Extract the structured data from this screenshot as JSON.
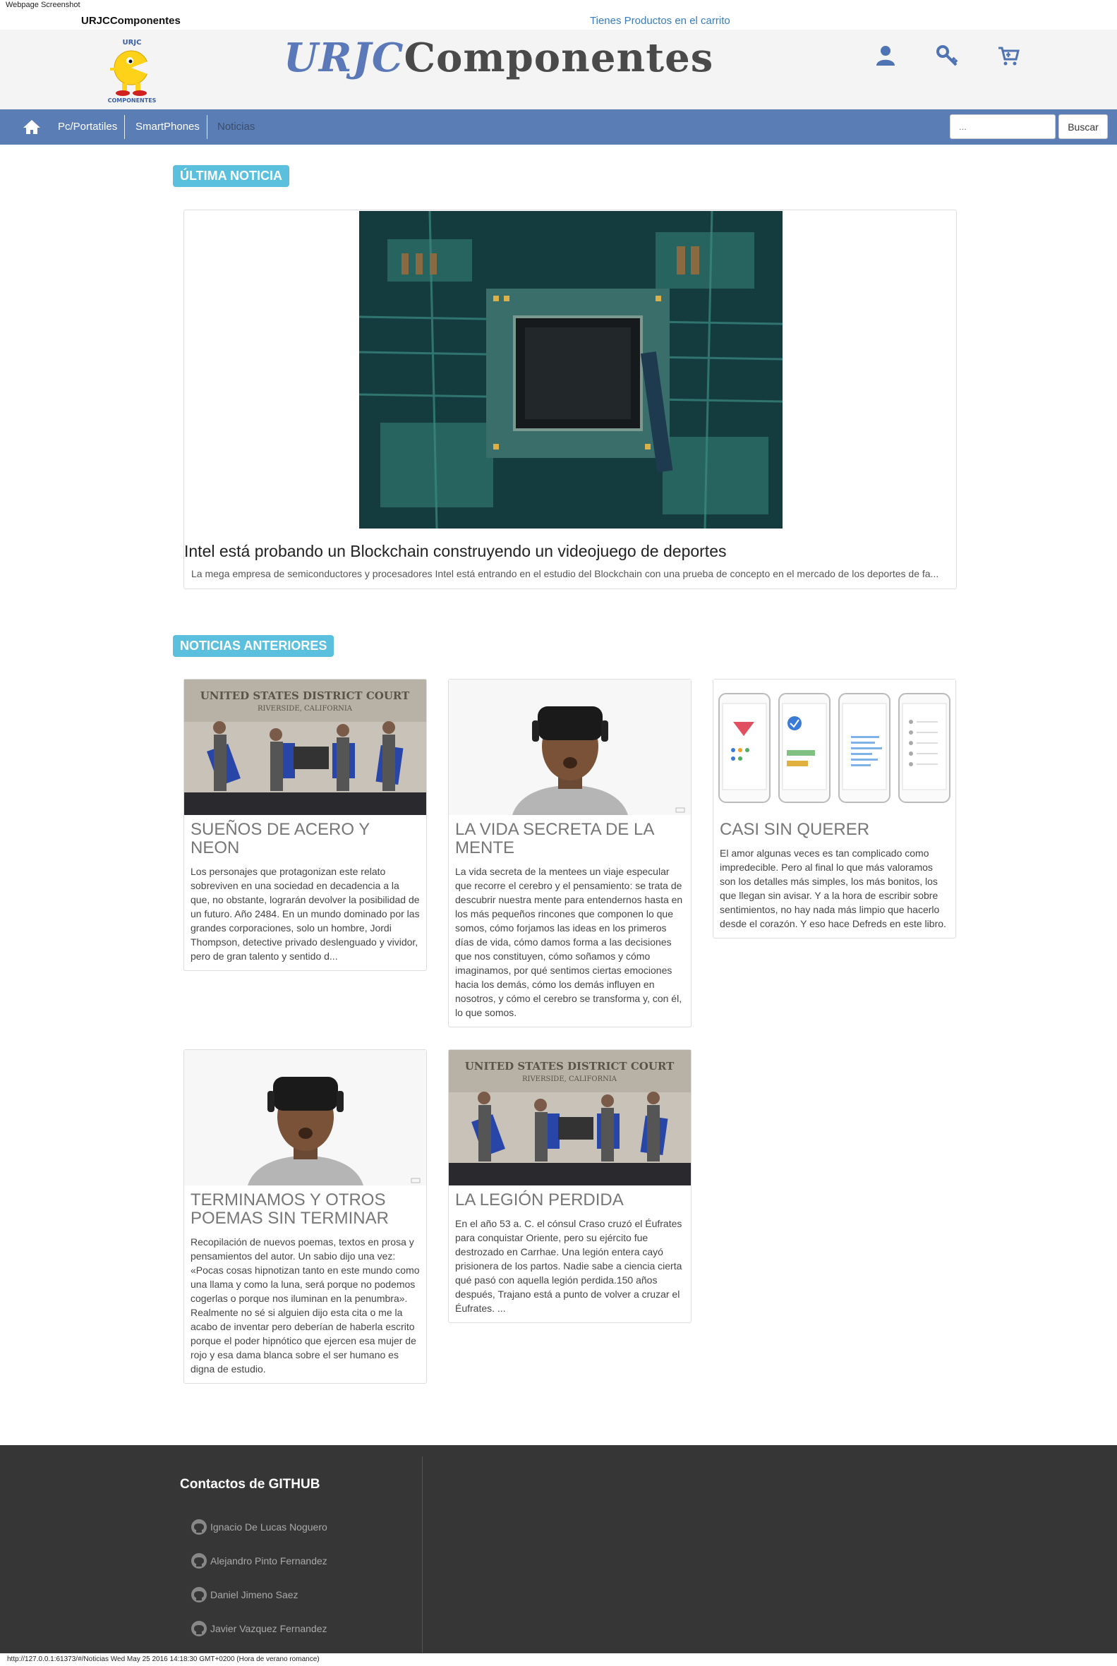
{
  "screenshot_caption": "Webpage Screenshot",
  "top": {
    "brand": "URJCComponentes",
    "cart_message": "Tienes Productos en el carrito"
  },
  "header": {
    "title_part1": "URJC",
    "title_part2": "Componentes",
    "logo_text_top": "URJC",
    "logo_text_bottom": "COMPONENTES",
    "icons": [
      "user-icon",
      "key-icon",
      "cart-icon"
    ]
  },
  "nav": {
    "items": [
      "Pc/Portatiles",
      "SmartPhones",
      "Noticias"
    ],
    "search_placeholder": "...",
    "search_button": "Buscar"
  },
  "latest": {
    "label": "ÚLTIMA NOTICIA",
    "title": "Intel está probando un Blockchain construyendo un videojuego de deportes",
    "desc": "La mega empresa de semiconductores y procesadores Intel está entrando en el estudio del Blockchain con una prueba de concepto en el mercado de los deportes de fa..."
  },
  "previous": {
    "label": "NOTICIAS ANTERIORES",
    "cards": [
      {
        "title": "SUEÑOS DE ACERO Y NEON",
        "desc": "Los personajes que protagonizan este relato sobreviven en una sociedad en decadencia a la que, no obstante, lograrán devolver la posibilidad de un futuro. Año 2484. En un mundo dominado por las grandes corporaciones, solo un hombre, Jordi Thompson, detective privado deslenguado y vividor, pero de gran talento y sentido d...",
        "image_sign": "UNITED STATES DISTRICT COURT",
        "image_sub": "RIVERSIDE, CALIFORNIA"
      },
      {
        "title": "LA VIDA SECRETA DE LA MENTE",
        "desc": "La vida secreta de la mentees un viaje especular que recorre el cerebro y el pensamiento: se trata de descubrir nuestra mente para entendernos hasta en los más pequeños rincones que componen lo que somos, cómo forjamos las ideas en los primeros días de vida, cómo damos forma a las decisiones que nos constituyen, cómo soñamos y cómo imaginamos, por qué sentimos ciertas emociones hacia los demás, cómo los demás influyen en nosotros, y cómo el cerebro se transforma y, con él, lo que somos."
      },
      {
        "title": "CASI SIN QUERER",
        "desc": "El amor algunas veces es tan complicado como impredecible. Pero al final lo que más valoramos son los detalles más simples, los más bonitos, los que llegan sin avisar. Y a la hora de escribir sobre sentimientos, no hay nada más limpio que hacerlo desde el corazón. Y eso hace Defreds en este libro."
      },
      {
        "title": "TERMINAMOS Y OTROS POEMAS SIN TERMINAR",
        "desc": "Recopilación de nuevos poemas, textos en prosa y pensamientos del autor. Un sabio dijo una vez: «Pocas cosas hipnotizan tanto en este mundo como una llama y como la luna, será porque no podemos cogerlas o porque nos iluminan en la penumbra». Realmente no sé si alguien dijo esta cita o me la acabo de inventar pero deberían de haberla escrito porque el poder hipnótico que ejercen esa mujer de rojo y esa dama blanca sobre el ser humano es digna de estudio."
      },
      {
        "title": "LA LEGIÓN PERDIDA",
        "desc": "En el año 53 a. C. el cónsul Craso cruzó el Éufrates para conquistar Oriente, pero su ejército fue destrozado en Carrhae. Una legión entera cayó prisionera de los partos. Nadie sabe a ciencia cierta qué pasó con aquella legión perdida.150 años después, Trajano está a punto de volver a cruzar el Éufrates. ...",
        "image_sign": "UNITED STATES DISTRICT COURT",
        "image_sub": "RIVERSIDE, CALIFORNIA"
      }
    ]
  },
  "footer": {
    "title": "Contactos de GITHUB",
    "links": [
      "Ignacio De Lucas Noguero",
      "Alejandro Pinto Fernandez",
      "Daniel Jimeno Saez",
      "Javier Vazquez Fernandez"
    ]
  },
  "statusbar": "http://127.0.0.1:61373/#/Noticias Wed May 25 2016 14:18:30 GMT+0200 (Hora de verano romance)",
  "colors": {
    "nav_bg": "#5b7db5",
    "label_bg": "#5bc0de",
    "footer_bg": "#363636",
    "accent": "#4f74b3"
  }
}
